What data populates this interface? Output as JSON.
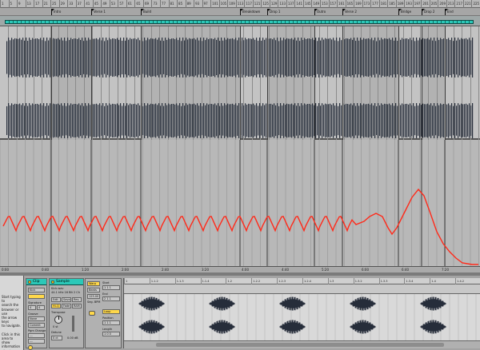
{
  "ruler": {
    "ticks": [
      "1",
      "5",
      "9",
      "13",
      "17",
      "21",
      "25",
      "29",
      "33",
      "37",
      "41",
      "45",
      "49",
      "53",
      "57",
      "61",
      "65",
      "69",
      "73",
      "77",
      "81",
      "85",
      "89",
      "93",
      "97",
      "101",
      "105",
      "109",
      "113",
      "117",
      "121",
      "125",
      "129",
      "133",
      "137",
      "141",
      "145",
      "149",
      "153",
      "157",
      "161",
      "165",
      "169",
      "173",
      "177",
      "181",
      "185",
      "189",
      "193",
      "197",
      "201",
      "205",
      "209",
      "213",
      "217",
      "221",
      "225"
    ]
  },
  "locators": [
    "Intro",
    "Verse 1",
    "Build",
    "Breakdown",
    "Drop 1",
    "Outro",
    "Verse 2",
    "Bridge",
    "Drop 2",
    "End"
  ],
  "timeline": [
    "0:00",
    "0:40",
    "1:20",
    "2:00",
    "2:40",
    "3:20",
    "4:00",
    "4:40",
    "5:20",
    "6:00",
    "6:40",
    "7:20"
  ],
  "info_panel": {
    "text": [
      "Start typing to",
      "search the",
      "browser or use",
      "the arrow keys",
      "to navigate.",
      "",
      "Click in this",
      "area to show",
      "information",
      "about settings",
      "or elements."
    ]
  },
  "clip_box": {
    "title": "Clip",
    "name": "Kick",
    "signature_label": "Signature",
    "sig_num": "4",
    "sig_den": "4",
    "groove_label": "Groove",
    "groove_value": "None",
    "commit_label": "Commit",
    "pgm_label": "Pgm Change",
    "bank": "---",
    "sub": "---",
    "pgm": "---"
  },
  "sample_box": {
    "title": "Sample",
    "filename": "Kick.wav",
    "rate": "44.1 kHz 16 Bit 2 Ch",
    "edit_label": "Edit",
    "save_label": "Save",
    "rev_label": "Rev.",
    "hires_label": "Hi-Q",
    "fade_label": "Fade",
    "ram_label": "RAM",
    "transpose_label": "Transpose",
    "transpose_value": "0 st",
    "detune_label": "Detune",
    "detune_value": "0 ct",
    "gain_value": "0.00 dB"
  },
  "control_box": {
    "warp_label": "Warp",
    "start_label": "Start",
    "start_value": "1 1 1",
    "end_label": "End",
    "end_value": "2 1 1",
    "seg_bpm_label": "Seg. BPM",
    "seg_bpm_value": "125.00",
    "loop_label": "Loop",
    "position_label": "Position",
    "position_value": "1 1 1",
    "length_label": "Length",
    "length_value": "1 0 0",
    "mode_value": "Beats"
  },
  "sample_editor": {
    "ticks": [
      "1",
      "1.1.2",
      "1.1.3",
      "1.1.4",
      "1.2",
      "1.2.2",
      "1.2.3",
      "1.2.4",
      "1.3",
      "1.3.2",
      "1.3.3",
      "1.3.4",
      "1.4",
      "1.4.2"
    ]
  },
  "colors": {
    "accent": "#2bc8b8",
    "automation": "#ff2a1a",
    "waveform": "#262d3a",
    "highlight": "#ffd84a"
  }
}
